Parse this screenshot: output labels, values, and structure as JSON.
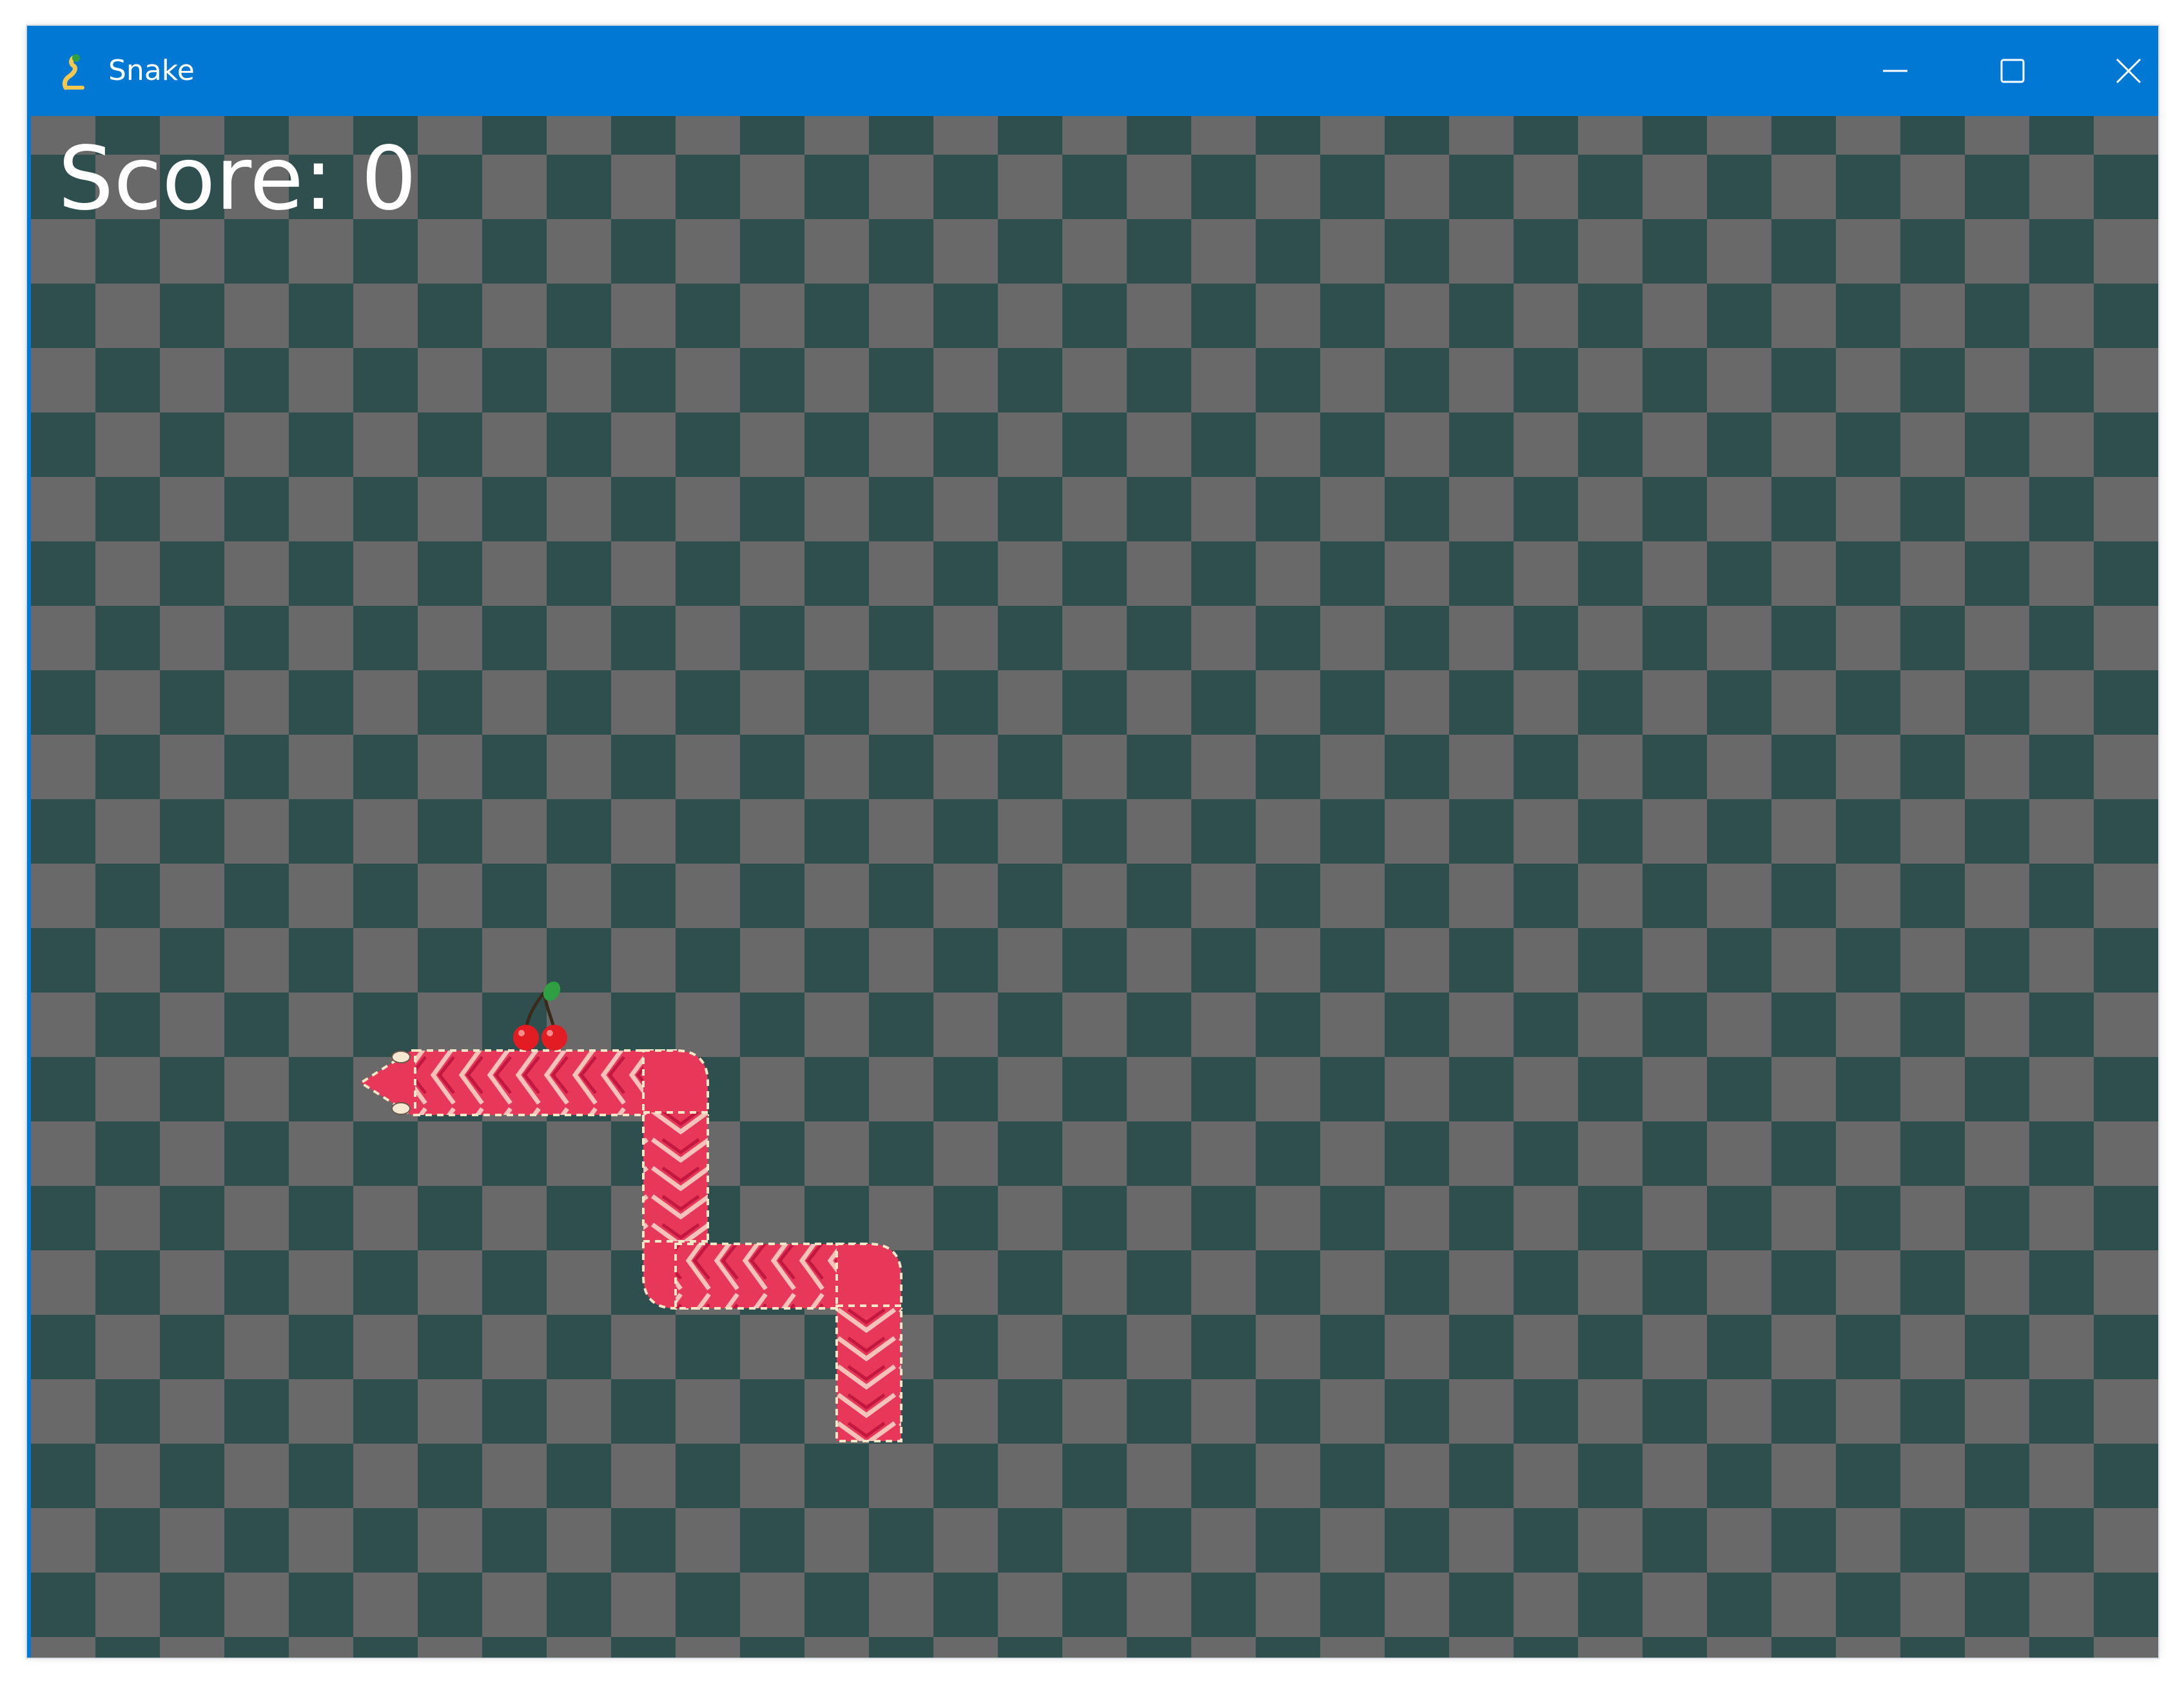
{
  "window": {
    "title": "Snake",
    "icon": "snake-app-icon",
    "controls": [
      "minimize-icon",
      "maximize-icon",
      "close-icon"
    ]
  },
  "colors": {
    "titlebar": "#0078d4",
    "board_light": "#696969",
    "board_dark": "#2f4f4f",
    "snake": "#e8385a",
    "snake_scale": "#f7c2b8",
    "cherry": "#e31b23"
  },
  "game": {
    "score_text": "Score: 0"
  }
}
